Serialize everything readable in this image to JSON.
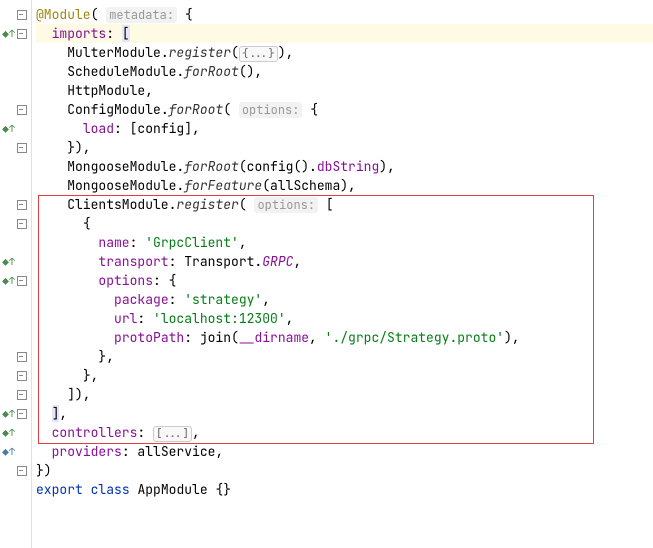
{
  "code": {
    "l1_dec": "@Module",
    "l1_hint": "metadata:",
    "l2_imports": "imports",
    "l3_mod": "MulterModule",
    "l3_meth": "register",
    "l3_fold": "{...}",
    "l4_mod": "ScheduleModule",
    "l4_meth": "forRoot",
    "l5_mod": "HttpModule",
    "l6_mod": "ConfigModule",
    "l6_meth": "forRoot",
    "l6_hint": "options:",
    "l7_key": "load",
    "l7_val": "config",
    "l9_mod": "MongooseModule",
    "l9_meth": "forRoot",
    "l9_fn": "config",
    "l9_prop": "dbString",
    "l10_mod": "MongooseModule",
    "l10_meth": "forFeature",
    "l10_arg": "allSchema",
    "l11_mod": "ClientsModule",
    "l11_meth": "register",
    "l11_hint": "options:",
    "l13_key": "name",
    "l13_val": "'GrpcClient'",
    "l14_key": "transport",
    "l14_obj": "Transport",
    "l14_prop": "GRPC",
    "l15_key": "options",
    "l16_key": "package",
    "l16_val": "'strategy'",
    "l17_key": "url",
    "l17_val": "'localhost:12300'",
    "l18_key": "protoPath",
    "l18_fn": "join",
    "l18_dir": "__dirname",
    "l18_path": "'./grpc/Strategy.proto'",
    "l23_key": "controllers",
    "l23_fold": "[...]",
    "l24_key": "providers",
    "l24_val": "allService",
    "l26_export": "export",
    "l26_class": "class",
    "l26_name": "AppModule"
  }
}
